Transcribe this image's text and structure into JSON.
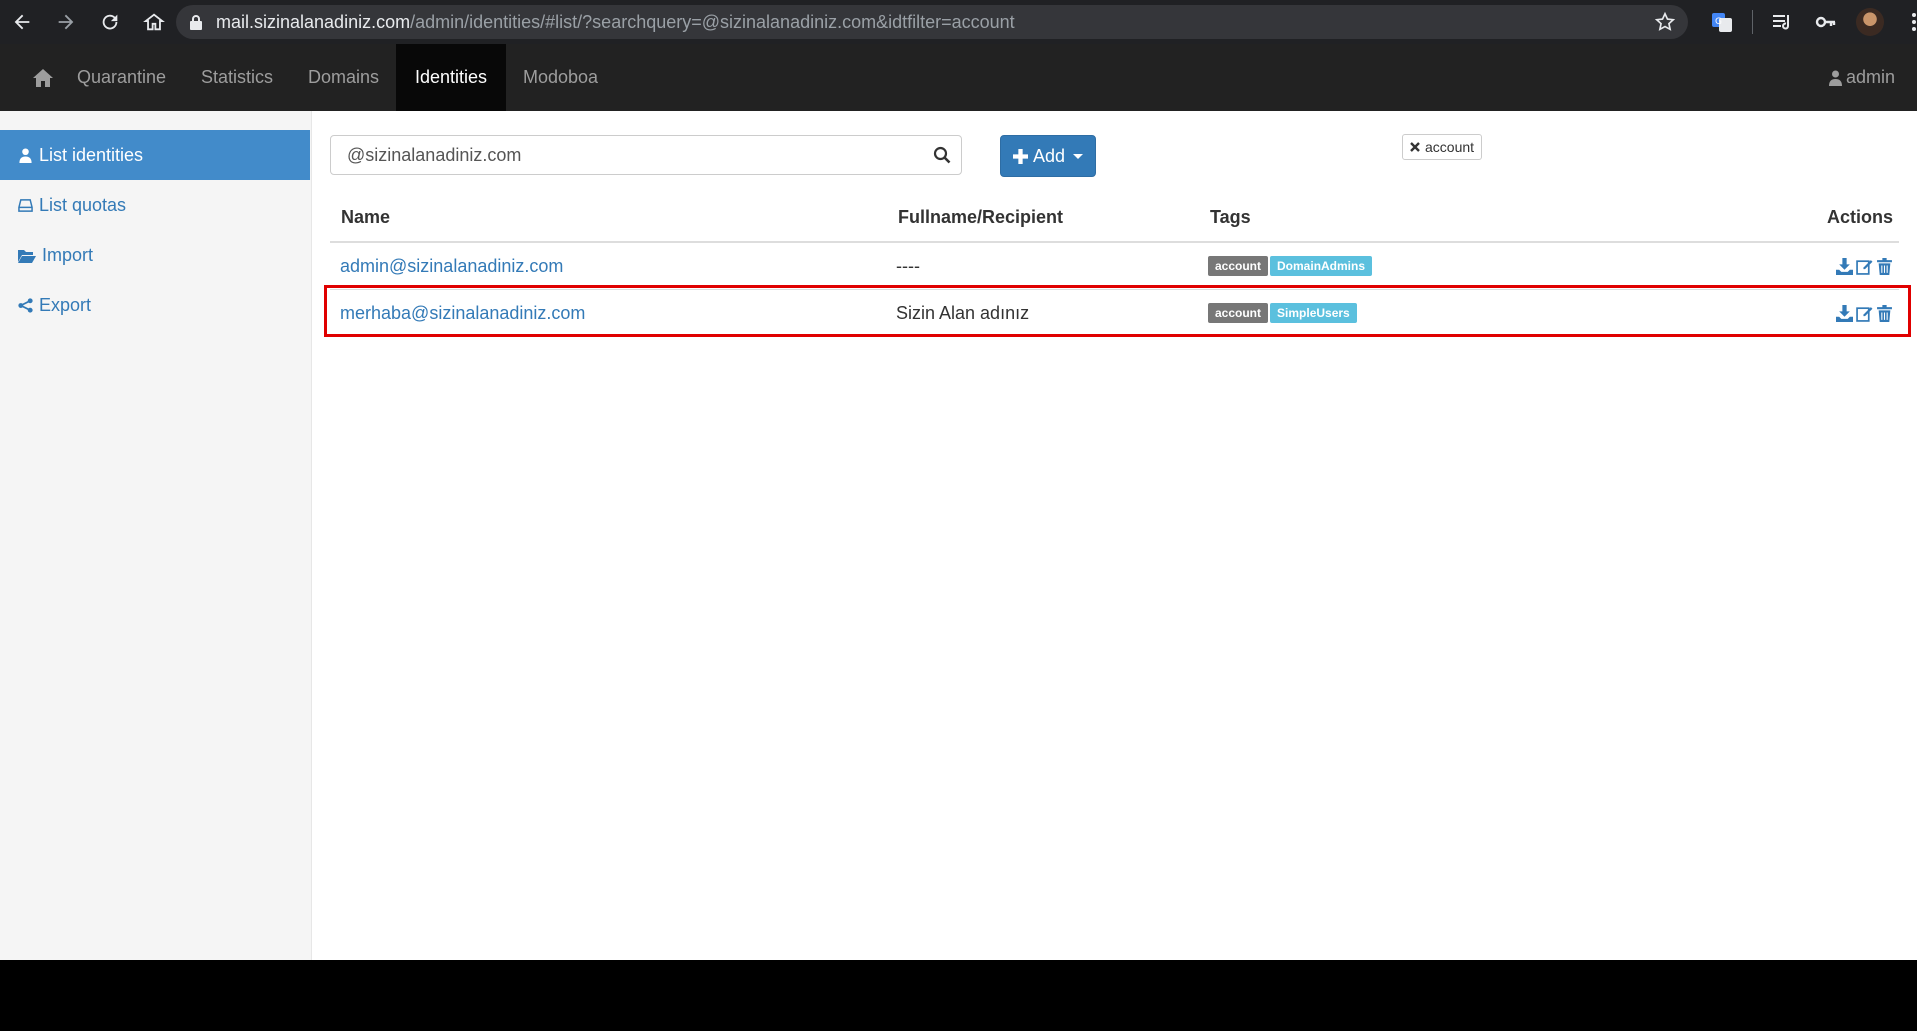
{
  "browser": {
    "url_host": "mail.sizinalanadiniz.com",
    "url_path": "/admin/identities/#list/?searchquery=@sizinalanadiniz.com&idtfilter=account"
  },
  "navbar": {
    "items": [
      {
        "label": "Quarantine",
        "active": false
      },
      {
        "label": "Statistics",
        "active": false
      },
      {
        "label": "Domains",
        "active": false
      },
      {
        "label": "Identities",
        "active": true
      },
      {
        "label": "Modoboa",
        "active": false
      }
    ],
    "user": "admin"
  },
  "sidebar": {
    "items": [
      {
        "label": "List identities",
        "icon": "user-icon",
        "active": true
      },
      {
        "label": "List quotas",
        "icon": "hdd-icon",
        "active": false
      },
      {
        "label": "Import",
        "icon": "folder-open-icon",
        "active": false
      },
      {
        "label": "Export",
        "icon": "share-icon",
        "active": false
      }
    ]
  },
  "toolbar": {
    "search_value": "@sizinalanadiniz.com",
    "add_label": "Add",
    "filter_label": "account"
  },
  "table": {
    "headers": {
      "name": "Name",
      "fullname": "Fullname/Recipient",
      "tags": "Tags",
      "actions": "Actions"
    },
    "rows": [
      {
        "name": "admin@sizinalanadiniz.com",
        "fullname": "----",
        "tag1": "account",
        "tag2": "DomainAdmins",
        "highlighted": false
      },
      {
        "name": "merhaba@sizinalanadiniz.com",
        "fullname": "Sizin Alan adınız",
        "tag1": "account",
        "tag2": "SimpleUsers",
        "highlighted": true
      }
    ]
  },
  "colors": {
    "primary": "#337ab7",
    "navbar_bg": "#222222",
    "highlight": "#e00000",
    "label_dark": "#777777",
    "label_info": "#5bc0de"
  }
}
